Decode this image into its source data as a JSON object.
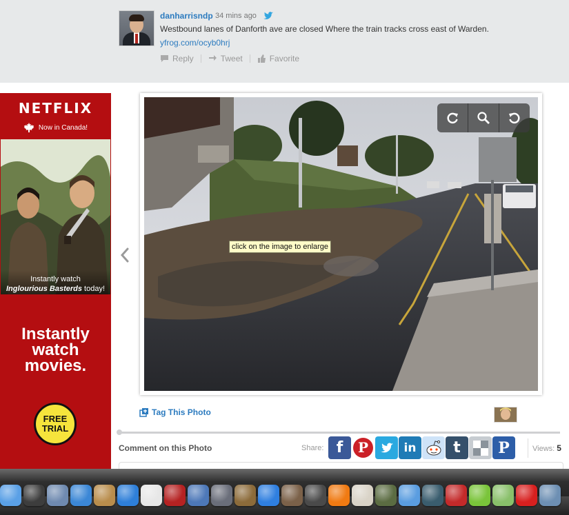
{
  "tweet": {
    "username": "danharrisndp",
    "time": "34 mins ago",
    "text": "Westbound lanes of Danforth ave are closed Where the train tracks cross east of Warden.",
    "link": "yfrog.com/ocyb0hrj",
    "actions": {
      "reply": "Reply",
      "tweet": "Tweet",
      "favorite": "Favorite"
    }
  },
  "ad": {
    "brand": "NETFLIX",
    "region": "Now in Canada!",
    "caption_line1": "Instantly watch",
    "caption_title": "Inglourious Basterds",
    "caption_tail": " today!",
    "headline_1": "Instantly",
    "headline_2": "watch",
    "headline_3": "movies.",
    "badge_1": "FREE",
    "badge_2": "TRIAL"
  },
  "viewer": {
    "tooltip": "click on the image to enlarge",
    "tools": [
      "rotate-right-icon",
      "zoom-icon",
      "rotate-left-icon"
    ]
  },
  "photo_page": {
    "tag_label": "Tag This Photo",
    "comment_heading": "Comment on this Photo",
    "share_label": "Share:",
    "views_label": "Views:",
    "views_count": "5",
    "share_buttons": [
      {
        "name": "facebook",
        "glyph": "f",
        "color": "#3b5998"
      },
      {
        "name": "pinterest",
        "glyph": "P",
        "color": "#cb2027"
      },
      {
        "name": "twitter",
        "glyph": "t",
        "color": "#2aa9e0"
      },
      {
        "name": "linkedin",
        "glyph": "in",
        "color": "#1f7bb6"
      },
      {
        "name": "reddit",
        "glyph": "r",
        "color": "#cee3f8"
      },
      {
        "name": "tumblr",
        "glyph": "t",
        "color": "#35506b"
      },
      {
        "name": "delicious",
        "glyph": "d",
        "color": "#9aa4ad"
      },
      {
        "name": "pinterest-alt",
        "glyph": "P",
        "color": "#2d5ea8"
      }
    ]
  },
  "dock": {
    "apps": [
      {
        "name": "finder",
        "color": "#5aa0e6"
      },
      {
        "name": "dashboard",
        "color": "#3d3d3d"
      },
      {
        "name": "mail",
        "color": "#6f8ab0"
      },
      {
        "name": "safari",
        "color": "#3b87d6"
      },
      {
        "name": "address-book",
        "color": "#b98d4c"
      },
      {
        "name": "itunes",
        "color": "#2e7fd9"
      },
      {
        "name": "ical",
        "color": "#e7e7e7"
      },
      {
        "name": "photo-booth",
        "color": "#b52222"
      },
      {
        "name": "iwork",
        "color": "#4d78b8"
      },
      {
        "name": "system-prefs",
        "color": "#6a6e7a"
      },
      {
        "name": "preview",
        "color": "#8c6b3a"
      },
      {
        "name": "app-store",
        "color": "#2f7fe0"
      },
      {
        "name": "contacts",
        "color": "#7b6149"
      },
      {
        "name": "imovie",
        "color": "#4a4a4a"
      },
      {
        "name": "vlc",
        "color": "#f07a12"
      },
      {
        "name": "bricks",
        "color": "#d9d3c7"
      },
      {
        "name": "twitter-bird",
        "color": "#5b6c42"
      },
      {
        "name": "angry-birds",
        "color": "#5a9de0"
      },
      {
        "name": "time-machine",
        "color": "#3a5d6e"
      },
      {
        "name": "angry-birds-red",
        "color": "#c42a2a"
      },
      {
        "name": "frog",
        "color": "#7ac43a"
      },
      {
        "name": "paper-plane",
        "color": "#89c06a"
      },
      {
        "name": "radio",
        "color": "#d8201f"
      },
      {
        "name": "folder",
        "color": "#6d8fb3"
      }
    ]
  }
}
